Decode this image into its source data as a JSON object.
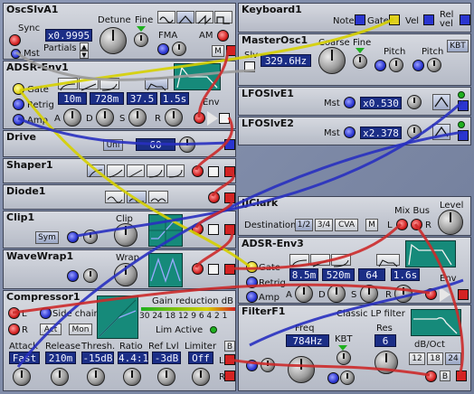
{
  "modules": {
    "osc_slv_a1": {
      "title": "OscSlvA1",
      "sync": "Sync",
      "mst": "Mst",
      "ratio": "x0.9995",
      "partials": "Partials",
      "detune": "Detune",
      "fine": "Fine",
      "fma": "FMA",
      "am": "AM",
      "m": "M"
    },
    "keyboard1": {
      "title": "Keyboard1",
      "note": "Note",
      "gate": "Gate",
      "vel": "Vel",
      "rel_vel": "Rel vel"
    },
    "master_osc1": {
      "title": "MasterOsc1",
      "slv": "Slv",
      "freq": "329.6Hz",
      "coarse": "Coarse",
      "fine": "Fine",
      "pitch1": "Pitch",
      "pitch2": "Pitch",
      "kbt": "KBT"
    },
    "adsr_env1": {
      "title": "ADSR-Env1",
      "gate": "Gate",
      "retrig": "Retrig",
      "amp": "Amp",
      "a_label": "A",
      "d_label": "D",
      "s_label": "S",
      "r_label": "R",
      "a": "10m",
      "d": "728m",
      "s": "37.5",
      "r": "1.5s",
      "env": "Env"
    },
    "lfo_slv_e1": {
      "title": "LFOSlvE1",
      "mst": "Mst",
      "ratio": "x0.530"
    },
    "lfo_slv_e2": {
      "title": "LFOSlvE2",
      "mst": "Mst",
      "ratio": "x2.378"
    },
    "drive": {
      "title": "Drive",
      "mode": "Uni",
      "value": "60"
    },
    "shaper1": {
      "title": "Shaper1"
    },
    "diode1": {
      "title": "Diode1"
    },
    "jjclark": {
      "title": "JJClark",
      "destination": "Destination",
      "opt1": "1/2",
      "opt2": "3/4",
      "opt3": "CVA",
      "m": "M",
      "mix_bus": "Mix Bus",
      "l": "L",
      "r": "R",
      "level": "Level"
    },
    "clip1": {
      "title": "Clip1",
      "sym": "Sym",
      "clip": "Clip"
    },
    "adsr_env3": {
      "title": "ADSR-Env3",
      "gate": "Gate",
      "retrig": "Retrig",
      "amp": "Amp",
      "a_label": "A",
      "d_label": "D",
      "s_label": "S",
      "r_label": "R",
      "a": "8.5m",
      "d": "520m",
      "s": "64",
      "r": "1.6s",
      "env": "Env"
    },
    "wavewrap1": {
      "title": "WaveWrap1",
      "wrap": "Wrap"
    },
    "compressor1": {
      "title": "Compressor1",
      "l": "L",
      "r": "R",
      "side_chain": "Side chain",
      "act": "Act",
      "mon": "Mon",
      "gain_reduction": "Gain reduction dB",
      "scale": "30 24 18 12  9  6  4  2  1",
      "lim_active": "Lim Active",
      "attack_label": "Attack",
      "release_label": "Release",
      "thresh_label": "Thresh.",
      "ratio_label": "Ratio",
      "ref_lvl_label": "Ref Lvl",
      "limiter_label": "Limiter",
      "attack": "Fast",
      "release": "210m",
      "thresh": "-15dB",
      "ratio": "4.4:1",
      "ref_lvl": "-3dB",
      "limiter": "Off",
      "b": "B"
    },
    "filter_f1": {
      "title": "FilterF1",
      "subtitle": "Classic LP filter",
      "freq_label": "Freq",
      "freq": "784Hz",
      "kbt": "KBT",
      "res_label": "Res",
      "res": "6",
      "db_oct": "dB/Oct",
      "opt12": "12",
      "opt18": "18",
      "opt24": "24",
      "b": "B"
    }
  },
  "colors": {
    "background": "#7a86a0",
    "module": "#c8ccd6",
    "lcd": "#1b2e86",
    "cable_red": "#cc2a2a",
    "cable_blue": "#2830c0",
    "cable_yellow": "#d6d000",
    "cable_gray": "#9a9a9a",
    "scope": "#168a7a"
  }
}
